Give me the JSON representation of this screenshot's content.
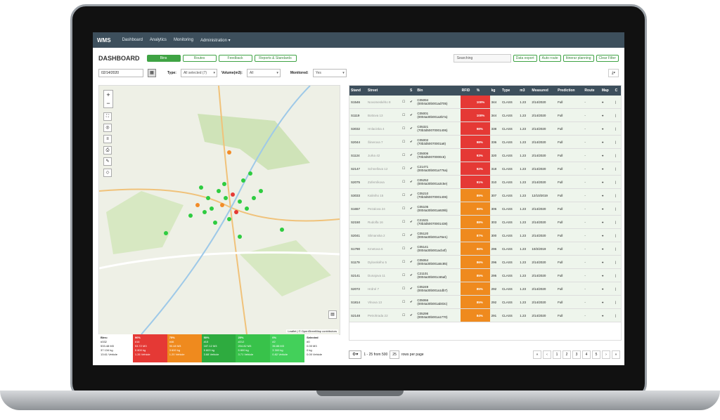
{
  "app": {
    "brand": "WMS"
  },
  "nav": [
    "Dashboard",
    "Analytics",
    "Monitoring",
    "Administration ▾"
  ],
  "page_title": "DASHBOARD",
  "tabs": [
    "Bins",
    "Routes",
    "Feedback",
    "Reports & Standards"
  ],
  "search_placeholder": "Searching",
  "right_buttons": [
    "Data export",
    "Auto route",
    "Itinerar planning",
    "Clear Filter"
  ],
  "filters": {
    "date": "02/14/2020",
    "type_label": "Type:",
    "type_value": "All selected (7)",
    "volume_label": "Volume(m3):",
    "volume_value": "All",
    "monitored_label": "Monitored:",
    "monitored_value": "Yes"
  },
  "map": {
    "attribution": "Leaflet | © OpenStreetMap contributors",
    "colors": {
      "green": "#2ecc40",
      "orange": "#f28c28",
      "red": "#e53935"
    }
  },
  "stats": [
    {
      "title": "Bins:",
      "l1": "#332",
      "l2": "533.48 M3",
      "l3": "37 134 kg",
      "l4": "13.61 Vehicle"
    },
    {
      "title": "90%",
      "l1": "#16",
      "l2": "53.72 M3",
      "l3": "5 800 kg",
      "l4": "1.26 Vehicle",
      "color": "#e53935"
    },
    {
      "title": "75%",
      "l1": "#46",
      "l2": "90.48 M3",
      "l3": "3 600 kg",
      "l4": "1.20 Vehicle",
      "color": "#ef8a1e"
    },
    {
      "title": "50%",
      "l1": "#15",
      "l2": "187.12 M3",
      "l3": "5 803 kg",
      "l4": "3.68 Vehicle",
      "color": "#2eab3f"
    },
    {
      "title": "25%",
      "l1": "#212",
      "l2": "204.82 M3",
      "l3": "5 800 kg",
      "l4": "3.71 Vehicle",
      "color": "#38c24a"
    },
    {
      "title": "0%",
      "l1": "#2",
      "l2": "36.88 M3",
      "l3": "3 300 kg",
      "l4": "0.82 Vehicle",
      "color": "#43d05a"
    },
    {
      "title": "Selected",
      "l1": "#0",
      "l2": "0.00 M3",
      "l3": "0 kg",
      "l4": "0.00 Vehicle"
    }
  ],
  "table": {
    "headers": [
      "Stand",
      "Street",
      "",
      "S",
      "Bin",
      "RFID",
      "%",
      "kg",
      "Type",
      "m3",
      "Measured",
      "Prediction",
      "Route",
      "Map",
      "C"
    ],
    "rows": [
      [
        "S1546",
        "Novomeského 8",
        "C05094\n(0004a30b001ad705)",
        "100%",
        "344",
        "2/14/2020"
      ],
      [
        "S1119",
        "Bottova 13",
        "C05001\n(0004a30b001a3b7a)",
        "100%",
        "344",
        "2/14/2020"
      ],
      [
        "S3032",
        "Hnlacinka 4",
        "C05321\n(70b3d50070001406)",
        "98%",
        "338",
        "2/14/2020"
      ],
      [
        "S2044",
        "Šinerova 7",
        "C05002\n(70b3d50070001a8)",
        "98%",
        "336",
        "2/14/2020"
      ],
      [
        "S1124",
        "Jurka 42",
        "C05006\n(70b3d50070000c6)",
        "93%",
        "320",
        "2/14/2020"
      ],
      [
        "S2147",
        "Schnellova 12",
        "C21471\n(0004a30b001a776a)",
        "92%",
        "318",
        "2/14/2020"
      ],
      [
        "S2075",
        "Zoferníkova",
        "C05252\n(0004a30b001a3c5e)",
        "91%",
        "310",
        "2/14/2020"
      ],
      [
        "S3033",
        "Kaliniho 15",
        "C05210\n(70b3d50070001406)",
        "89%",
        "307",
        "12/10/2019"
      ],
      [
        "S1657",
        "Pezalova 24",
        "C05105\n(0004a30b001a929b)",
        "89%",
        "306",
        "2/14/2020"
      ],
      [
        "S2150",
        "Rudolfa 16",
        "C21531\n(70b3d50070001438)",
        "88%",
        "303",
        "2/14/2020"
      ],
      [
        "S2041",
        "Slimanska 2",
        "C05120\n(0004a30b001a76e1)",
        "87%",
        "300",
        "2/14/2020"
      ],
      [
        "S1790",
        "Kmetova 6",
        "C05141\n(0004a30b001acb4f)",
        "86%",
        "296",
        "10/2/2019"
      ],
      [
        "S1179",
        "Dylovského 5",
        "C05064\n(0004a30b001a5c85)",
        "86%",
        "296",
        "2/14/2020"
      ],
      [
        "S2141",
        "Dunajova 11",
        "C21101\n(0004a30b001c65af)",
        "85%",
        "295",
        "2/14/2020"
      ],
      [
        "S2072",
        "Hrdné 7",
        "C05249\n(0004a30b001a1db7)",
        "85%",
        "292",
        "2/14/2020"
      ],
      [
        "S1814",
        "Vlnova 13",
        "C05066\n(0004a30b001ab03c)",
        "85%",
        "292",
        "2/14/2020"
      ],
      [
        "S2148",
        "Petrohrada 22",
        "C05298\n(0004a30b001a1770)",
        "84%",
        "291",
        "2/14/2020"
      ]
    ],
    "type": "CLASS",
    "m3": "1.23",
    "prediction": "Full",
    "route": "-"
  },
  "pager": {
    "info": "1 - 25 from 500",
    "per_page": "25",
    "per_label": "rows per page",
    "pages": [
      "«",
      "‹",
      "1",
      "2",
      "3",
      "4",
      "5",
      "›",
      "»"
    ]
  }
}
